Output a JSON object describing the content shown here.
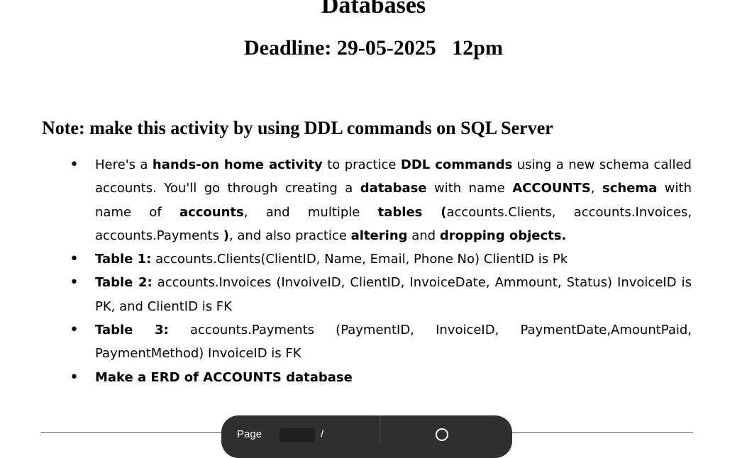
{
  "doc": {
    "title": "Databases",
    "deadline": "Deadline: 29-05-2025   12pm",
    "note": "Note: make this activity by using DDL commands on SQL Server"
  },
  "items": [
    {
      "runs": [
        {
          "t": "Here's a ",
          "b": false
        },
        {
          "t": "hands-on home activity",
          "b": true
        },
        {
          "t": " to practice ",
          "b": false
        },
        {
          "t": "DDL commands",
          "b": true
        },
        {
          "t": " using a new schema called accounts. You'll go through creating a ",
          "b": false
        },
        {
          "t": "database",
          "b": true
        },
        {
          "t": " with name ",
          "b": false
        },
        {
          "t": "ACCOUNTS",
          "b": true
        },
        {
          "t": ", ",
          "b": false
        },
        {
          "t": "schema",
          "b": true
        },
        {
          "t": " with name of ",
          "b": false
        },
        {
          "t": "accounts",
          "b": true
        },
        {
          "t": ", and multiple ",
          "b": false
        },
        {
          "t": "tables (",
          "b": true
        },
        {
          "t": "accounts.Clients, accounts.Invoices, accounts.Payments ",
          "b": false
        },
        {
          "t": ")",
          "b": true
        },
        {
          "t": ", and also practice ",
          "b": false
        },
        {
          "t": "altering",
          "b": true
        },
        {
          "t": " and ",
          "b": false
        },
        {
          "t": "dropping objects.",
          "b": true
        }
      ]
    },
    {
      "runs": [
        {
          "t": "Table 1:",
          "b": true
        },
        {
          "t": "  accounts.Clients(ClientID, Name, Email, Phone No)     ClientID is Pk",
          "b": false
        }
      ]
    },
    {
      "runs": [
        {
          "t": "Table 2:",
          "b": true
        },
        {
          "t": " accounts.Invoices (InvoiveID, ClientID, InvoiceDate, Ammount, Status) InvoiceID is PK, and ClientID is FK",
          "b": false
        }
      ]
    },
    {
      "runs": [
        {
          "t": "Table 3:",
          "b": true
        },
        {
          "t": " accounts.Payments  (PaymentID, InvoiceID, PaymentDate,AmountPaid, PaymentMethod) InvoiceID is FK",
          "b": false
        }
      ]
    },
    {
      "runs": [
        {
          "t": "Make a ERD of ACCOUNTS database",
          "b": true
        }
      ]
    }
  ],
  "pagebar": {
    "page_label": "Page",
    "slash": "/"
  },
  "icons": {
    "zoom": "zoom-icon"
  }
}
